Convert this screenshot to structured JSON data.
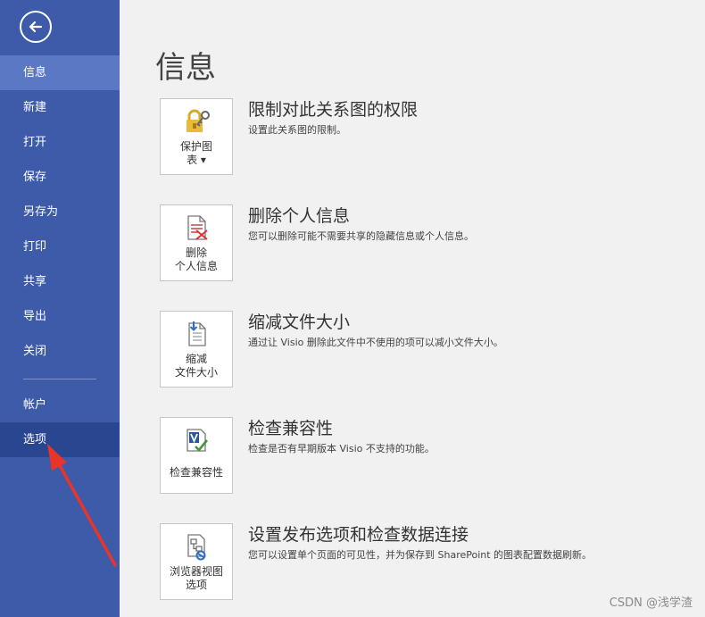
{
  "sidebar": {
    "items": [
      {
        "label": "信息"
      },
      {
        "label": "新建"
      },
      {
        "label": "打开"
      },
      {
        "label": "保存"
      },
      {
        "label": "另存为"
      },
      {
        "label": "打印"
      },
      {
        "label": "共享"
      },
      {
        "label": "导出"
      },
      {
        "label": "关闭"
      }
    ],
    "bottom_items": [
      {
        "label": "帐户"
      },
      {
        "label": "选项"
      }
    ],
    "active": "信息",
    "selected": "选项"
  },
  "main": {
    "title": "信息",
    "sections": [
      {
        "button_label": "保护图\n表 ▾",
        "title": "限制对此关系图的权限",
        "desc": "设置此关系图的限制。",
        "icon": "lock-key-icon"
      },
      {
        "button_label": "删除\n个人信息",
        "title": "删除个人信息",
        "desc": "您可以删除可能不需要共享的隐藏信息或个人信息。",
        "icon": "remove-info-icon"
      },
      {
        "button_label": "缩减\n文件大小",
        "title": "缩减文件大小",
        "desc": "通过让 Visio 删除此文件中不使用的项可以减小文件大小。",
        "icon": "reduce-file-icon"
      },
      {
        "button_label": "检查兼容性",
        "title": "检查兼容性",
        "desc": "检查是否有早期版本 Visio 不支持的功能。",
        "icon": "compat-check-icon"
      },
      {
        "button_label": "浏览器视图\n选项",
        "title": "设置发布选项和检查数据连接",
        "desc": "您可以设置单个页面的可见性，并为保存到 SharePoint 的图表配置数据刷新。",
        "icon": "browser-view-icon"
      }
    ]
  },
  "watermark": "CSDN @浅学渣",
  "colors": {
    "sidebar": "#3d5ba8",
    "active": "#5b78c4",
    "selected": "#2b4690",
    "arrow": "#e8342a"
  }
}
